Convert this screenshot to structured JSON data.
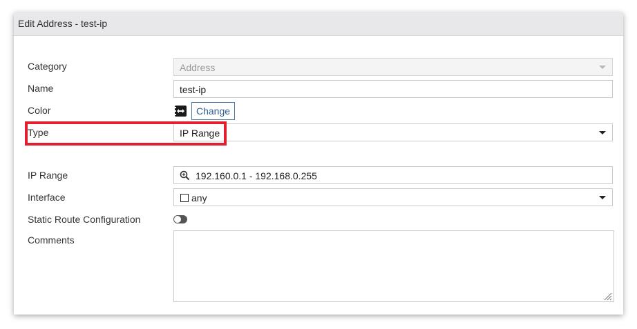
{
  "dialog": {
    "title": "Edit Address - test-ip"
  },
  "form": {
    "category": {
      "label": "Category",
      "value": "Address"
    },
    "name": {
      "label": "Name",
      "value": "test-ip"
    },
    "color": {
      "label": "Color",
      "change_label": "Change"
    },
    "type": {
      "label": "Type",
      "value": "IP Range"
    },
    "ip_range": {
      "label": "IP Range",
      "value": "192.160.0.1 - 192.168.0.255"
    },
    "interface": {
      "label": "Interface",
      "value": "any"
    },
    "static_route": {
      "label": "Static Route Configuration",
      "enabled": false
    },
    "comments": {
      "label": "Comments",
      "value": ""
    }
  },
  "colors": {
    "highlight": "#e0202f",
    "accent": "#2f5f8f"
  },
  "icons": {
    "color_swatch": "color-swatch-icon",
    "search": "search-icon",
    "dropdown": "chevron-down-icon",
    "resize": "resize-grip-icon"
  }
}
